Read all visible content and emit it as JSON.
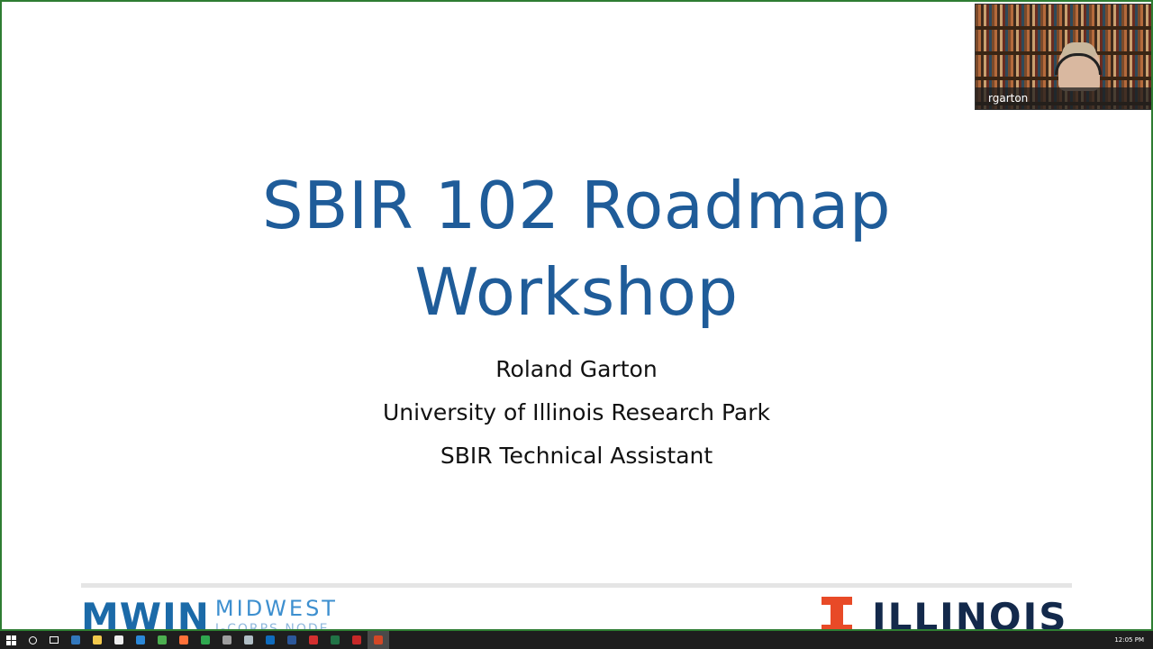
{
  "slide": {
    "title_line1": "SBIR 102 Roadmap",
    "title_line2": "Workshop",
    "presenter": "Roland Garton",
    "organization": "University of Illinois Research Park",
    "role": "SBIR Technical Assistant",
    "logo_left": {
      "word": "MWIN",
      "sub1": "MIDWEST",
      "sub2": "I-CORPS NODE"
    },
    "logo_right": {
      "word": "ILLINOIS"
    },
    "colors": {
      "title": "#1f5c99",
      "accent_orange": "#e84a27",
      "navy": "#13294b",
      "mwin_blue": "#1b6aa8"
    }
  },
  "video": {
    "participant_name": "rgarton"
  },
  "taskbar": {
    "icons": [
      {
        "name": "windows-start-icon"
      },
      {
        "name": "cortana-search-icon"
      },
      {
        "name": "task-view-icon"
      },
      {
        "name": "edge-browser-icon",
        "color": "#3277bc"
      },
      {
        "name": "file-explorer-icon",
        "color": "#f2c94c"
      },
      {
        "name": "store-icon",
        "color": "#eeeeee"
      },
      {
        "name": "mail-icon",
        "color": "#2b88d8"
      },
      {
        "name": "chrome-icon",
        "color": "#4caf50"
      },
      {
        "name": "firefox-icon",
        "color": "#ff7139"
      },
      {
        "name": "chat-icon",
        "color": "#2fa84f"
      },
      {
        "name": "notepad-icon",
        "color": "#9e9e9e"
      },
      {
        "name": "app-icon",
        "color": "#b0bec5"
      },
      {
        "name": "outlook-icon",
        "color": "#0f6cbd"
      },
      {
        "name": "word-icon",
        "color": "#2b579a"
      },
      {
        "name": "acrobat-icon",
        "color": "#d32f2f"
      },
      {
        "name": "excel-icon",
        "color": "#217346"
      },
      {
        "name": "pdf-icon",
        "color": "#c62828"
      },
      {
        "name": "powerpoint-icon",
        "color": "#d24726"
      }
    ],
    "clock": "12:05 PM"
  }
}
